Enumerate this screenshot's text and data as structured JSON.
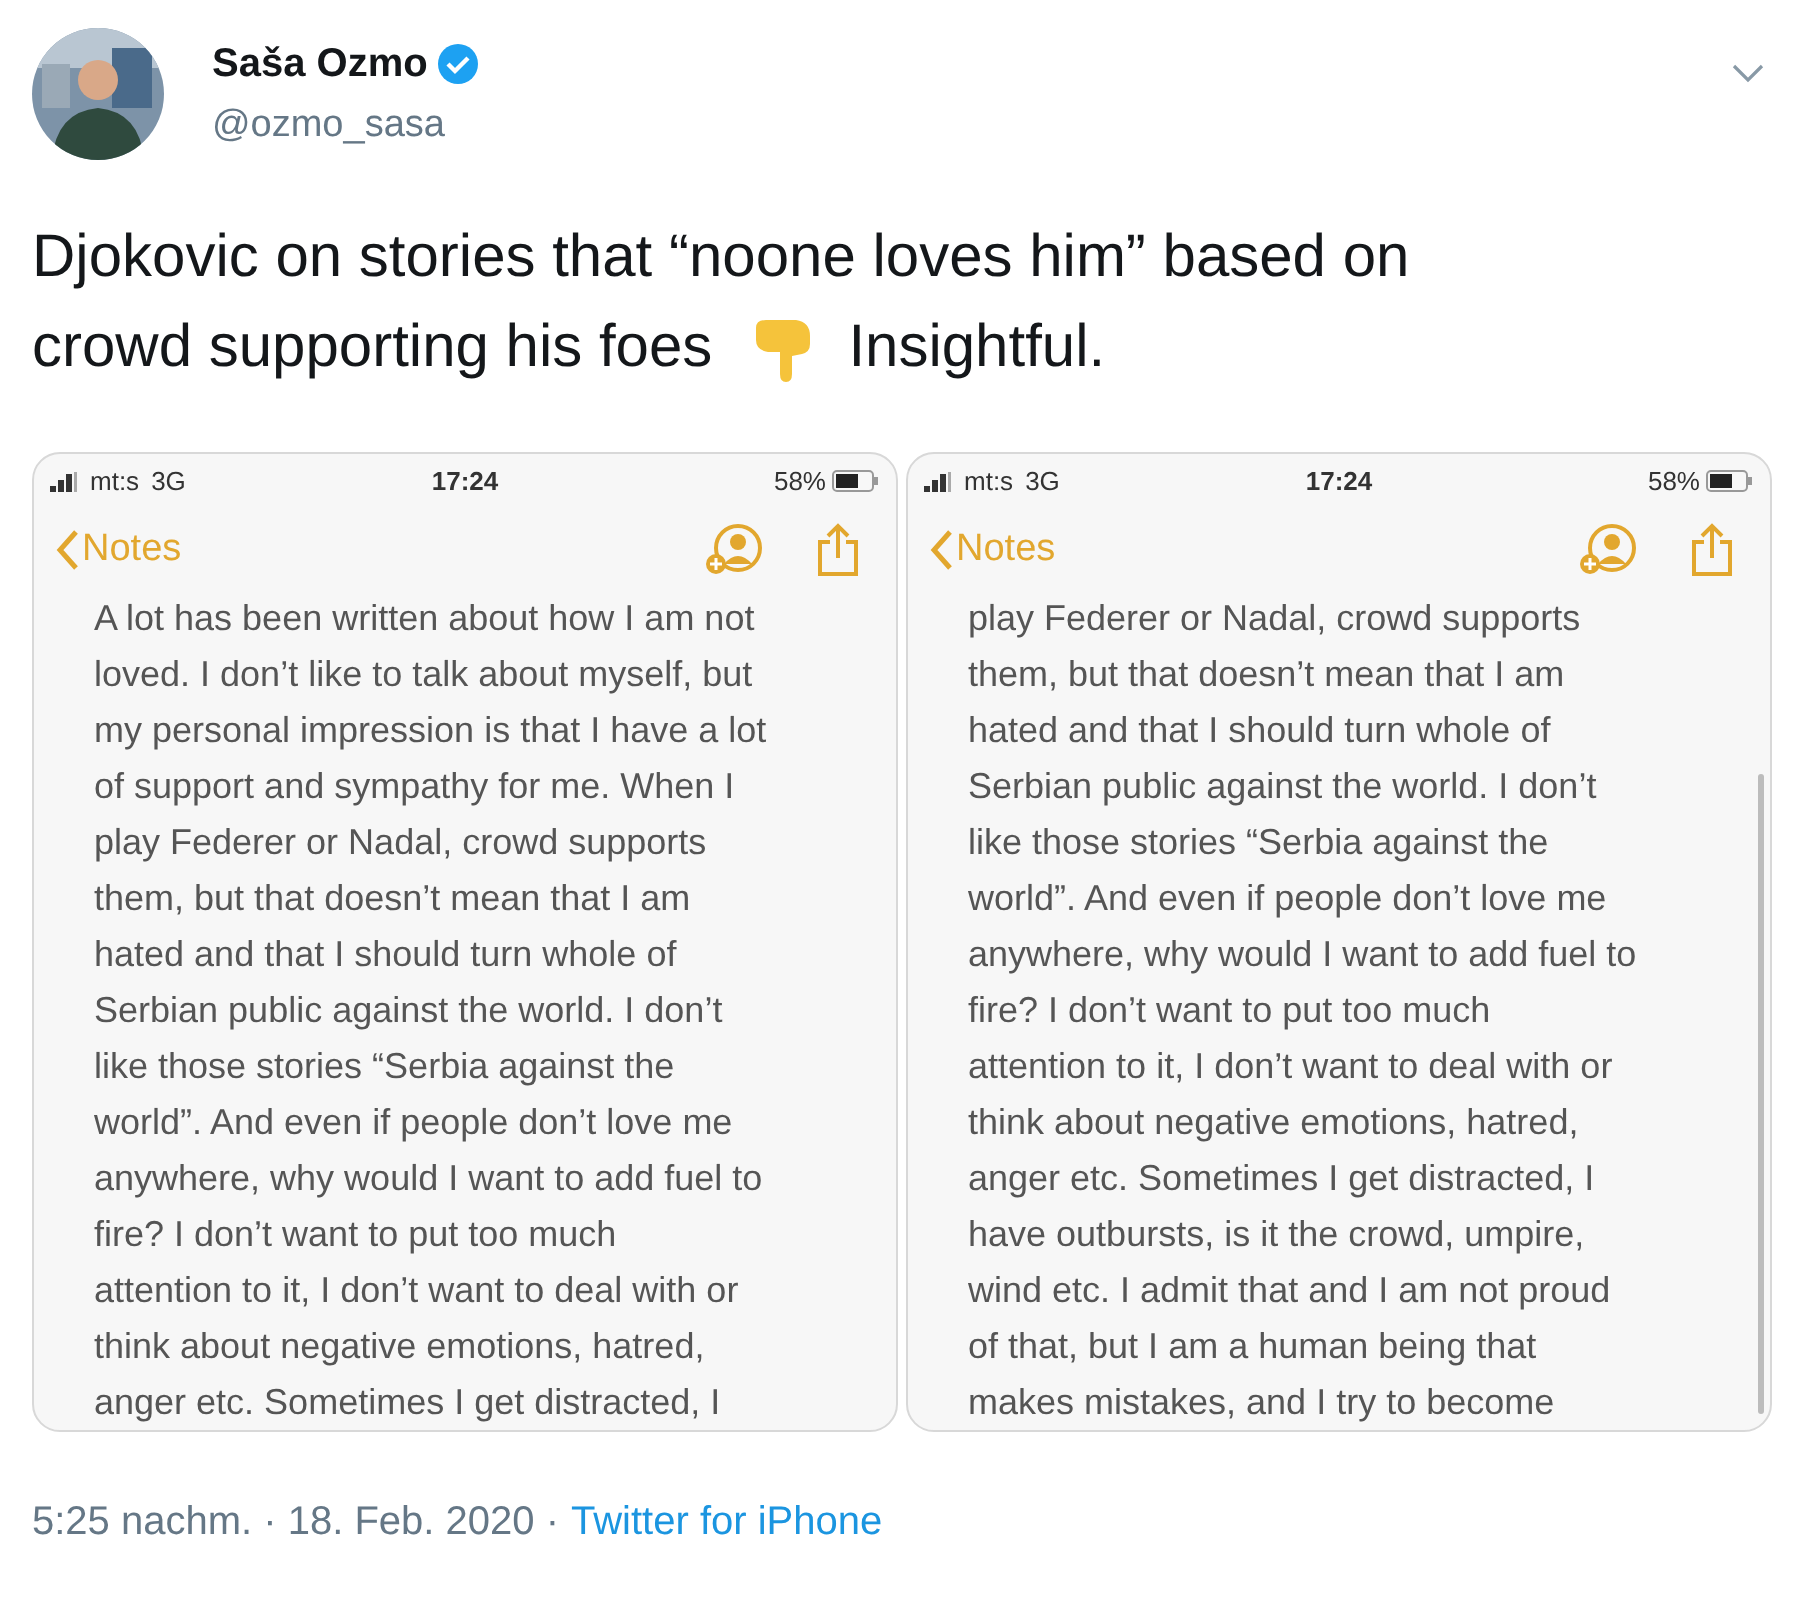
{
  "author": {
    "name": "Saša Ozmo",
    "handle": "@ozmo_sasa",
    "verified": true
  },
  "tweet": {
    "line_1": "Djokovic on stories that “noone loves him” based on",
    "line_2": "crowd supporting his foes",
    "text_after": "Insightful."
  },
  "phones": [
    {
      "status": {
        "carrier": "mt:s",
        "network": "3G",
        "time": "17:24",
        "battery": "58%"
      },
      "back": "Notes",
      "scrollbar": false,
      "lines": [
        "A lot has been written about how I am not",
        "loved. I don’t like to talk about myself, but",
        "my personal impression is that I have a lot",
        "of support and sympathy for me. When I",
        "play Federer or Nadal, crowd supports",
        "them, but that doesn’t mean that I am",
        "hated and that I should turn whole of",
        "Serbian public against the world. I don’t",
        "like those stories “Serbia against the",
        "world”. And even if people don’t love me",
        "anywhere, why would I want to add fuel to",
        "fire? I don’t want to put too much",
        "attention to it, I don’t want to deal with or",
        "think about negative emotions, hatred,",
        "anger etc. Sometimes I get distracted, I"
      ]
    },
    {
      "status": {
        "carrier": "mt:s",
        "network": "3G",
        "time": "17:24",
        "battery": "58%"
      },
      "back": "Notes",
      "scrollbar": true,
      "lines": [
        "play Federer or Nadal, crowd supports",
        "them, but that doesn’t mean that I am",
        "hated and that I should turn whole of",
        "Serbian public against the world. I don’t",
        "like those stories “Serbia against the",
        "world”. And even if people don’t love me",
        "anywhere, why would I want to add fuel to",
        "fire? I don’t want to put too much",
        "attention to it, I don’t want to deal with or",
        "think about negative emotions, hatred,",
        "anger etc. Sometimes I get distracted, I",
        "have outbursts, is it the crowd, umpire,",
        "wind etc. I admit that and I am not proud",
        "of that, but I am a human being that",
        "makes mistakes, and I try to become"
      ]
    }
  ],
  "footer": {
    "time": "5:25 nachm. · 18. Feb. 2020 ·",
    "source": "Twitter for iPhone"
  }
}
